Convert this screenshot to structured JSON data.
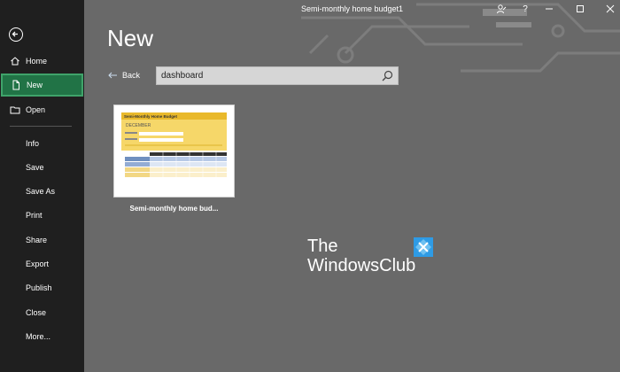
{
  "window": {
    "title": "Semi-monthly home budget1"
  },
  "sidebar": {
    "items": [
      {
        "label": "Home"
      },
      {
        "label": "New"
      },
      {
        "label": "Open"
      },
      {
        "label": "Info"
      },
      {
        "label": "Save"
      },
      {
        "label": "Save As"
      },
      {
        "label": "Print"
      },
      {
        "label": "Share"
      },
      {
        "label": "Export"
      },
      {
        "label": "Publish"
      },
      {
        "label": "Close"
      },
      {
        "label": "More..."
      }
    ]
  },
  "main": {
    "heading": "New",
    "back_label": "Back",
    "search": {
      "value": "dashboard"
    },
    "templates": [
      {
        "title": "Semi-monthly home bud...",
        "preview": {
          "title": "Semi-Monthly Home Budget",
          "month": "DECEMBER"
        }
      }
    ]
  },
  "window_controls": [
    "?"
  ],
  "watermark": {
    "line1": "The",
    "line2": "WindowsClub"
  },
  "colors": {
    "sidebar_bg": "#1f1f1f",
    "selected_bg": "#217346",
    "main_bg": "#696969"
  }
}
